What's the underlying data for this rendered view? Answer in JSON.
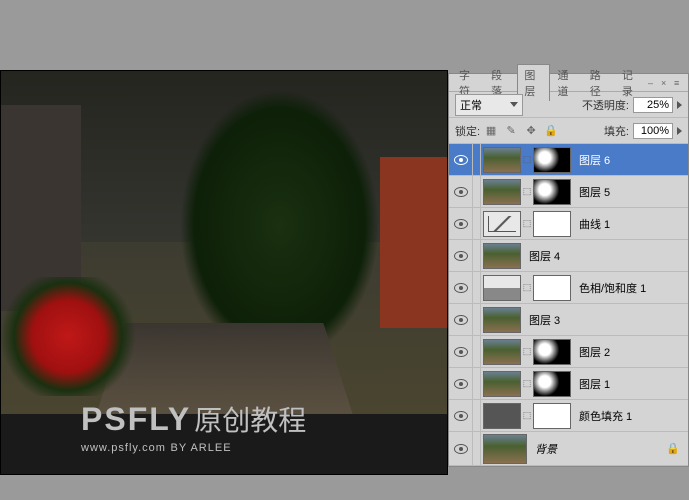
{
  "tabs": {
    "char": "字符",
    "para": "段落",
    "layers": "图层",
    "channels": "通道",
    "paths": "路径",
    "history": "记录"
  },
  "blend": {
    "mode": "正常",
    "opacity_label": "不透明度:",
    "opacity": "25%"
  },
  "lock": {
    "label": "锁定:",
    "fill_label": "填充:",
    "fill": "100%"
  },
  "layers_list": [
    {
      "name": "图层 6",
      "sel": true,
      "mask": "cloud"
    },
    {
      "name": "图层 5",
      "mask": "cloud"
    },
    {
      "name": "曲线 1",
      "adj": "curve",
      "mask": "w"
    },
    {
      "name": "图层 4",
      "mask": null
    },
    {
      "name": "色相/饱和度 1",
      "adj": "hue",
      "mask": "w"
    },
    {
      "name": "图层 3",
      "mask": null
    },
    {
      "name": "图层 2",
      "mask": "cloud"
    },
    {
      "name": "图层 1",
      "mask": "cloud"
    },
    {
      "name": "颜色填充 1",
      "adj": "fill",
      "mask": "w"
    },
    {
      "name": "背景",
      "bg": true
    }
  ],
  "watermark": {
    "logo": "PSFLY",
    "cn": "原创教程",
    "url": "www.psfly.com",
    "by": "BY ARLEE"
  }
}
